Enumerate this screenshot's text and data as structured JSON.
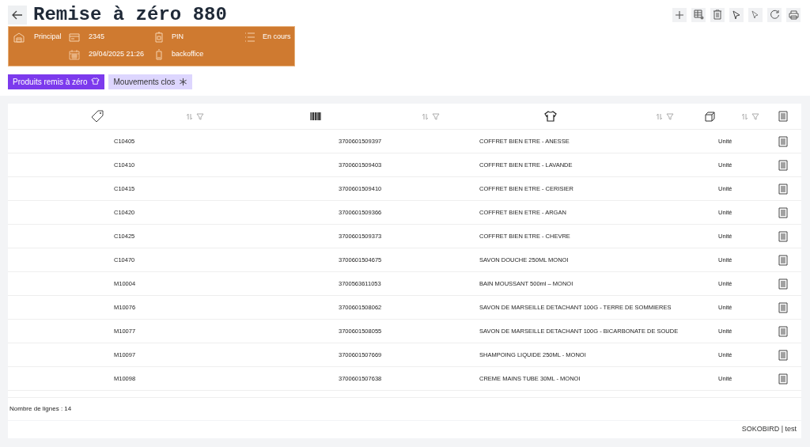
{
  "title": "Remise à zéro 880",
  "info": [
    {
      "kind": "warehouse",
      "text": "Principal"
    },
    {
      "kind": "card",
      "text": "2345"
    },
    {
      "kind": "badge",
      "text": "PIN"
    },
    {
      "kind": "list",
      "text": "En cours"
    },
    {
      "kind": "calendar",
      "text": "29/04/2025 21:26"
    },
    {
      "kind": "phone",
      "text": "backoffice"
    }
  ],
  "tabs": [
    {
      "label": "Produits remis à zéro",
      "selected": true,
      "kind": "shirt"
    },
    {
      "label": "Mouvements clos",
      "selected": false,
      "kind": "asterisk"
    }
  ],
  "table": {
    "rows": [
      {
        "code": "C10405",
        "barcode": "3700601509397",
        "name": "COFFRET BIEN ETRE - ANESSE",
        "unit": "Unité"
      },
      {
        "code": "C10410",
        "barcode": "3700601509403",
        "name": "COFFRET BIEN ETRE - LAVANDE",
        "unit": "Unité"
      },
      {
        "code": "C10415",
        "barcode": "3700601509410",
        "name": "COFFRET BIEN ETRE - CERISIER",
        "unit": "Unité"
      },
      {
        "code": "C10420",
        "barcode": "3700601509366",
        "name": "COFFRET BIEN ETRE - ARGAN",
        "unit": "Unité"
      },
      {
        "code": "C10425",
        "barcode": "3700601509373",
        "name": "COFFRET BIEN ETRE - CHEVRE",
        "unit": "Unité"
      },
      {
        "code": "C10470",
        "barcode": "3700601504675",
        "name": "SAVON DOUCHE 250ML MONOI",
        "unit": "Unité"
      },
      {
        "code": "M10004",
        "barcode": "3700563611053",
        "name": "BAIN MOUSSANT 500ml – MONOI",
        "unit": "Unité"
      },
      {
        "code": "M10076",
        "barcode": "3700601508062",
        "name": "SAVON DE MARSEILLE DETACHANT 100G - TERRE DE SOMMIERES",
        "unit": "Unité"
      },
      {
        "code": "M10077",
        "barcode": "3700601508055",
        "name": "SAVON DE MARSEILLE DETACHANT 100G - BICARBONATE DE SOUDE",
        "unit": "Unité"
      },
      {
        "code": "M10097",
        "barcode": "3700601507669",
        "name": "SHAMPOING LIQUIDE 250ML - MONOI",
        "unit": "Unité"
      },
      {
        "code": "M10098",
        "barcode": "3700601507638",
        "name": "CREME MAINS TUBE 30ML - MONOI",
        "unit": "Unité"
      }
    ],
    "footer": "Nombre de lignes : 14"
  },
  "status_bar": "SOKOBIRD | test"
}
